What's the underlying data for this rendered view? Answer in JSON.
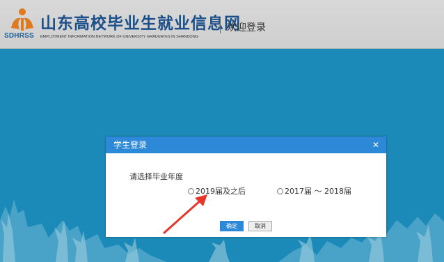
{
  "header": {
    "logo_abbr": "SDHRSS",
    "title": "山东高校毕业生就业信息网",
    "subtitle": "EMPLOYMENT INFORMATION NETWORK OF UNIVERSITY GRADUATES IN SHANDONG",
    "welcome": "欢迎登录"
  },
  "colors": {
    "background": "#1b8ab8",
    "header_bar": "#d6d6d6",
    "brand_blue": "#1b4f8a",
    "modal_header": "#2d89d8",
    "annotation_arrow": "#e8352a"
  },
  "modal": {
    "title": "学生登录",
    "close_label": "✕",
    "prompt": "请选择毕业年度",
    "options": [
      {
        "label": "2019届及之后",
        "selected": false
      },
      {
        "label": "2017届 ～ 2018届",
        "selected": false
      }
    ],
    "confirm_label": "确定",
    "cancel_label": "取消"
  }
}
